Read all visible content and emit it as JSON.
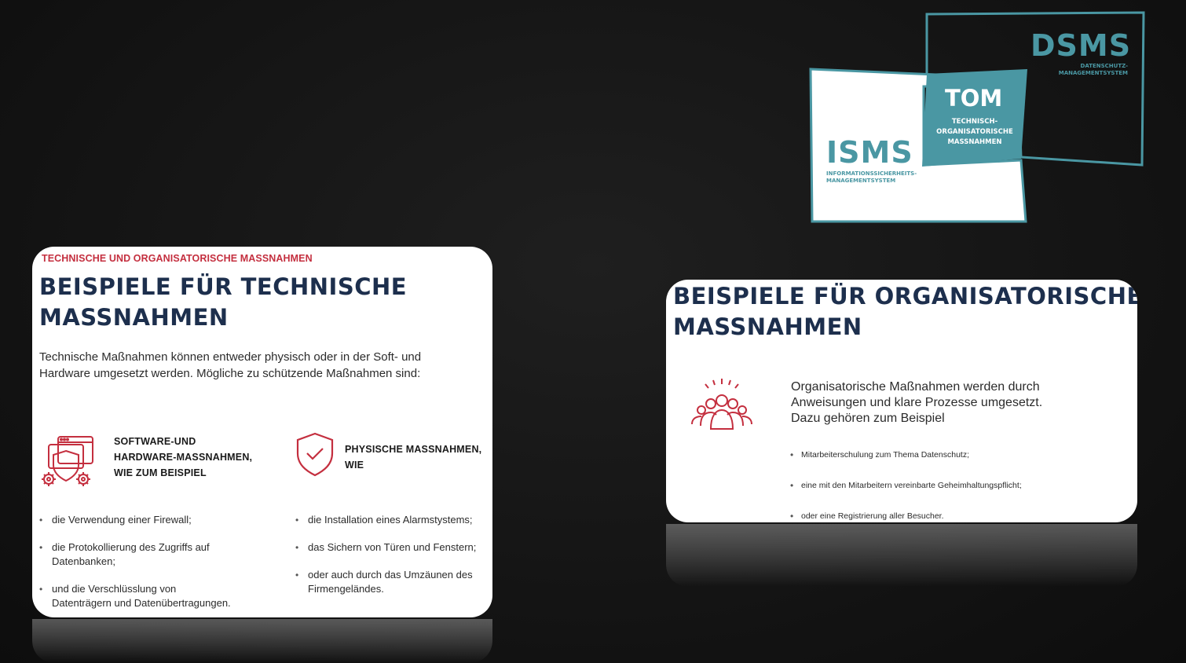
{
  "logo": {
    "dsms": "DSMS",
    "dsms_sub_1": "DATENSCHUTZ-",
    "dsms_sub_2": "MANAGEMENTSYSTEM",
    "tom": "TOM",
    "tom_sub_1": "TECHNISCH-",
    "tom_sub_2": "ORGANISATORISCHE",
    "tom_sub_3": "MASSNAHMEN",
    "isms": "ISMS",
    "isms_sub_1": "INFORMATIONSSICHERHEITS-",
    "isms_sub_2": "MANAGEMENTSYSTEM",
    "accent_color": "#4a97a3"
  },
  "tech_card": {
    "kicker": "TECHNISCHE UND ORGANISATORISCHE MASSNAHMEN",
    "title_line1": "BEISPIELE FÜR TECHNISCHE",
    "title_line2": "MASSNAHMEN",
    "intro_line1": "Technische Maßnahmen können entweder physisch oder in der Soft- und",
    "intro_line2": "Hardware umgesetzt werden. Mögliche zu schützende Maßnahmen sind:",
    "left_col": {
      "icon": "software-shield-gears-icon",
      "head_line1": "SOFTWARE-UND",
      "head_line2": "HARDWARE-MASSNAHMEN,",
      "head_line3": "WIE ZUM BEISPIEL",
      "bullets": [
        {
          "l1": "die Verwendung einer Firewall;",
          "l2": ""
        },
        {
          "l1": "die Protokollierung des Zugriffs auf",
          "l2": "Datenbanken;"
        },
        {
          "l1": "und die Verschlüsslung von",
          "l2": "Datenträgern und Datenübertragungen."
        }
      ]
    },
    "right_col": {
      "icon": "shield-check-icon",
      "head_line1": "PHYSISCHE MASSNAHMEN,",
      "head_line2": "WIE",
      "bullets": [
        {
          "l1": "die Installation eines Alarmstystems;",
          "l2": ""
        },
        {
          "l1": "das Sichern von Türen und Fenstern;",
          "l2": ""
        },
        {
          "l1": "oder auch durch das Umzäunen des",
          "l2": "Firmengeländes."
        }
      ]
    },
    "accent_color": "#c42f3f"
  },
  "org_card": {
    "title_line1": "BEISPIELE FÜR ORGANISATORISCHE",
    "title_line2": "MASSNAHMEN",
    "icon": "team-group-icon",
    "text_line1": "Organisatorische Maßnahmen werden durch",
    "text_line2": "Anweisungen und klare Prozesse umgesetzt.",
    "text_line3": "Dazu gehören zum Beispiel",
    "bullets": [
      "Mitarbeiterschulung zum Thema Datenschutz;",
      "eine mit den Mitarbeitern vereinbarte  Geheimhaltungspflicht;",
      "oder eine Registrierung aller Besucher."
    ]
  }
}
